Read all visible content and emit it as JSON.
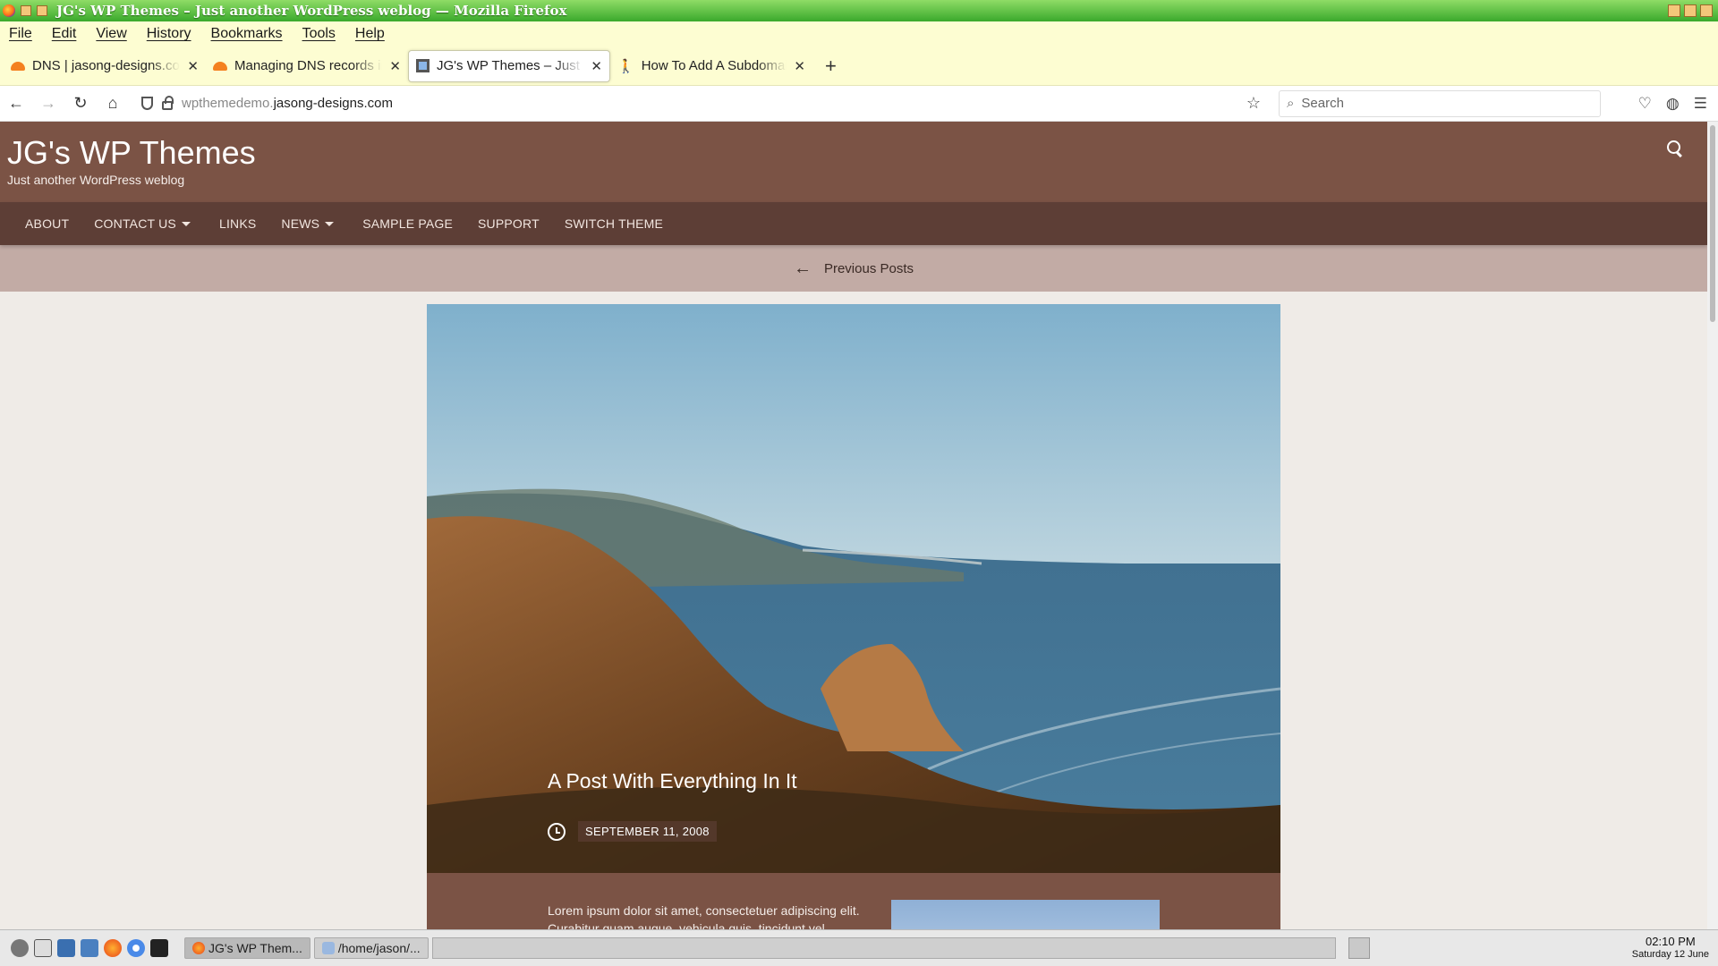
{
  "window": {
    "title": "JG's WP Themes – Just another WordPress weblog — Mozilla Firefox"
  },
  "menu": [
    "File",
    "Edit",
    "View",
    "History",
    "Bookmarks",
    "Tools",
    "Help"
  ],
  "tabs": [
    {
      "label": "DNS | jasong-designs.com",
      "icon": "cloudflare-icon",
      "active": false
    },
    {
      "label": "Managing DNS records in",
      "icon": "cloudflare-icon",
      "active": false
    },
    {
      "label": "JG's WP Themes – Just an",
      "icon": "wordpress-site-icon",
      "active": true
    },
    {
      "label": "How To Add A Subdomain",
      "icon": "walker-icon",
      "active": false
    }
  ],
  "address": {
    "host": "wpthemedemo.",
    "domain": "jasong-designs.com"
  },
  "search": {
    "placeholder": "Search"
  },
  "site": {
    "title": "JG's WP Themes",
    "tagline": "Just another WordPress weblog",
    "nav": [
      "ABOUT",
      "CONTACT US",
      "LINKS",
      "NEWS",
      "SAMPLE PAGE",
      "SUPPORT",
      "SWITCH THEME"
    ],
    "previous_posts": "Previous Posts"
  },
  "post": {
    "title": "A Post With Everything In It",
    "date": "SEPTEMBER 11, 2008",
    "excerpt": "Lorem ipsum dolor sit amet, consectetuer adipiscing elit. Curabitur quam augue, vehicula quis, tincidunt vel"
  },
  "taskbar": {
    "tasks": [
      "JG's WP Them...",
      "/home/jason/..."
    ],
    "time": "02:10 PM",
    "date": "Saturday 12 June"
  },
  "colors": {
    "header": "#7b5345",
    "nav": "#5d3e36",
    "postnav": "#c2aba5",
    "titlebar": "#3aa92c"
  }
}
